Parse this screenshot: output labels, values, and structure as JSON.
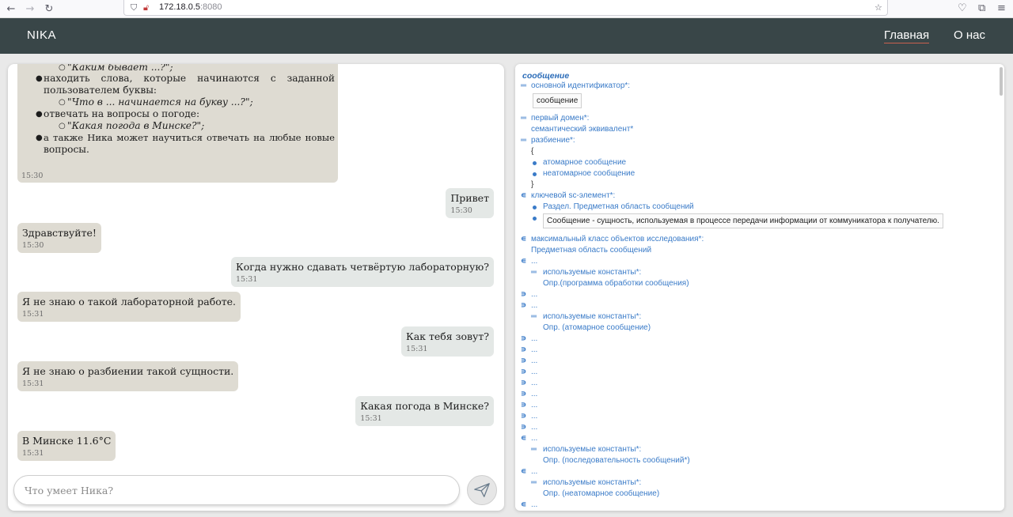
{
  "browser": {
    "url_host": "172.18.0.5",
    "url_port": ":8080"
  },
  "navbar": {
    "brand": "NIKA",
    "links": [
      "Главная",
      "О нас"
    ]
  },
  "chat": {
    "long_message": {
      "lines": [
        "\"Каким бывает ...?\";",
        "находить слова, которые начинаются с заданной",
        "пользователем буквы:",
        "\"Что в ... начинается на букву ...?\";",
        "отвечать на вопросы о погоде:",
        "\"Какая погода в Минске?\";",
        "а также Ника может научиться отвечать на любые новые",
        "вопросы."
      ],
      "time": "15:30"
    },
    "messages": [
      {
        "who": "user",
        "text": "Привет",
        "time": "15:30"
      },
      {
        "who": "bot",
        "text": "Здравствуйте!",
        "time": "15:30"
      },
      {
        "who": "user",
        "text": "Когда нужно сдавать четвёртую лабораторную?",
        "time": "15:31"
      },
      {
        "who": "bot",
        "text": "Я не знаю о такой лабораторной работе.",
        "time": "15:31"
      },
      {
        "who": "user",
        "text": "Как тебя зовут?",
        "time": "15:31"
      },
      {
        "who": "bot",
        "text": "Я не знаю о разбиении такой сущности.",
        "time": "15:31"
      },
      {
        "who": "user",
        "text": "Какая погода в Минске?",
        "time": "15:31"
      },
      {
        "who": "bot",
        "text": "В Минске 11.6°С",
        "time": "15:31"
      }
    ],
    "input_placeholder": "Что умеет Ника?"
  },
  "sc": {
    "title": "сообщение",
    "main_id_rel": "основной идентификатор*:",
    "main_id_value": "сообщение",
    "first_domain_rel": "первый домен*:",
    "semantic_eq": "семантический эквивалент*",
    "partition_rel": "разбиение*:",
    "open_brace": "{",
    "atomic": "атомарное сообщение",
    "non_atomic": "неатомарное сообщение",
    "close_brace": "}",
    "key_elem_rel": "ключевой sc-элемент*:",
    "section": "Раздел. Предметная область сообщений",
    "definition": "Сообщение - сущность, используемая в процессе передачи информации от коммуникатора к получателю.",
    "max_class_rel": "максимальный класс объектов исследования*:",
    "domain_msgs": "Предметная область сообщений",
    "ellipsis": "...",
    "used_constants": "используемые константы*:",
    "def1": "Опр.(программа обработки сообщения)",
    "def2": "Опр. (атомарное сообщение)",
    "def3": "Опр. (последовательность сообщений*)",
    "def4": "Опр. (неатомарное сообщение)"
  }
}
